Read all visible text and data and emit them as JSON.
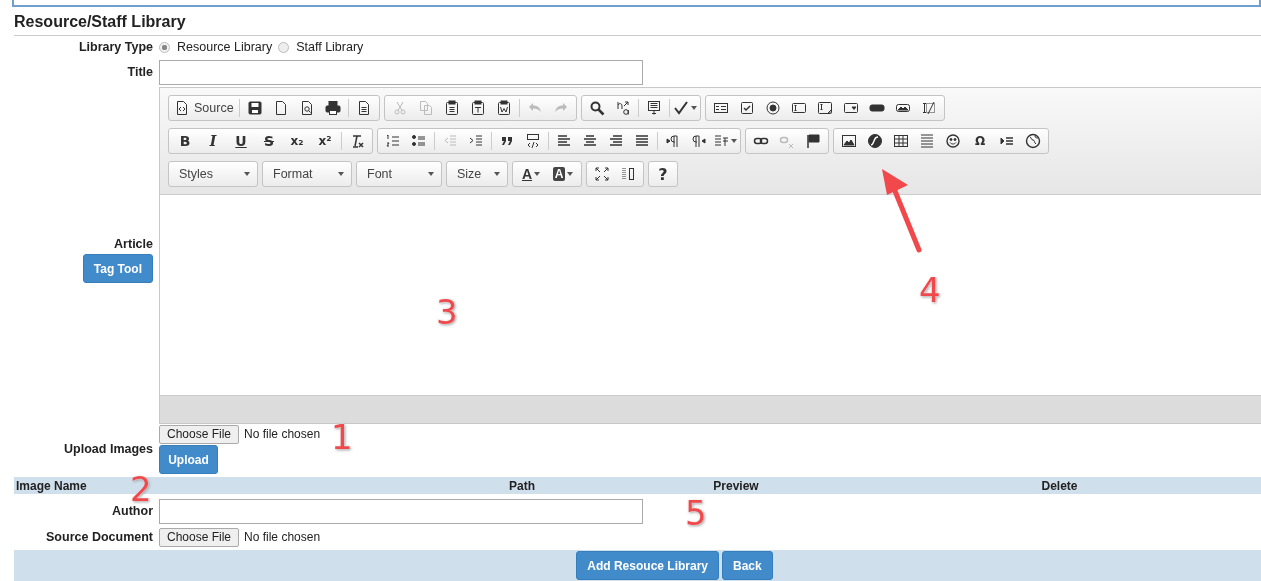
{
  "page_title": "Resource/Staff Library",
  "library_type": {
    "label": "Library Type",
    "options": [
      {
        "label": "Resource Library",
        "selected": true
      },
      {
        "label": "Staff Library",
        "selected": false
      }
    ]
  },
  "title_field": {
    "label": "Title"
  },
  "article": {
    "label": "Article",
    "tag_tool_button": "Tag Tool",
    "toolbar_rows": [
      {
        "groups": [
          {
            "items": [
              {
                "kind": "source",
                "text": "Source"
              },
              {
                "kind": "separator"
              },
              {
                "kind": "icon",
                "disabled": false
              },
              {
                "kind": "icon",
                "disabled": false
              },
              {
                "kind": "icon",
                "disabled": false
              },
              {
                "kind": "icon",
                "disabled": false
              },
              {
                "kind": "separator"
              },
              {
                "kind": "icon",
                "disabled": false
              }
            ]
          },
          {
            "items": [
              {
                "kind": "icon",
                "disabled": true
              },
              {
                "kind": "icon",
                "disabled": true
              },
              {
                "kind": "icon",
                "disabled": false
              },
              {
                "kind": "icon",
                "disabled": false
              },
              {
                "kind": "icon",
                "disabled": false
              },
              {
                "kind": "separator"
              },
              {
                "kind": "icon",
                "disabled": true
              },
              {
                "kind": "icon",
                "disabled": true
              }
            ]
          },
          {
            "items": [
              {
                "kind": "icon",
                "disabled": false
              },
              {
                "kind": "icon",
                "disabled": false
              },
              {
                "kind": "separator"
              },
              {
                "kind": "icon",
                "disabled": false
              },
              {
                "kind": "separator"
              },
              {
                "kind": "dropdown",
                "disabled": false
              }
            ]
          },
          {
            "items": [
              {
                "kind": "icon",
                "disabled": false
              },
              {
                "kind": "icon",
                "disabled": false
              },
              {
                "kind": "icon",
                "disabled": false
              },
              {
                "kind": "icon",
                "disabled": false
              },
              {
                "kind": "icon",
                "disabled": false
              },
              {
                "kind": "icon",
                "disabled": false
              },
              {
                "kind": "icon",
                "disabled": false
              },
              {
                "kind": "icon",
                "disabled": false
              },
              {
                "kind": "icon",
                "disabled": false
              }
            ]
          }
        ]
      },
      {
        "groups": [
          {
            "items": [
              {
                "kind": "glyph",
                "text": "B"
              },
              {
                "kind": "glyph",
                "text": "I"
              },
              {
                "kind": "glyph",
                "text": "U"
              },
              {
                "kind": "glyph",
                "text": "S"
              },
              {
                "kind": "glyph",
                "text": "x₂"
              },
              {
                "kind": "glyph",
                "text": "x²"
              },
              {
                "kind": "separator"
              },
              {
                "kind": "icon",
                "disabled": false
              }
            ]
          },
          {
            "items": [
              {
                "kind": "icon",
                "disabled": false
              },
              {
                "kind": "icon",
                "disabled": false
              },
              {
                "kind": "separator"
              },
              {
                "kind": "icon",
                "disabled": true
              },
              {
                "kind": "icon",
                "disabled": false
              },
              {
                "kind": "separator"
              },
              {
                "kind": "icon",
                "disabled": false
              },
              {
                "kind": "icon",
                "disabled": false
              },
              {
                "kind": "separator"
              },
              {
                "kind": "icon",
                "disabled": false
              },
              {
                "kind": "icon",
                "disabled": false
              },
              {
                "kind": "icon",
                "disabled": false
              },
              {
                "kind": "icon",
                "disabled": false
              },
              {
                "kind": "separator"
              },
              {
                "kind": "icon",
                "disabled": false
              },
              {
                "kind": "icon",
                "disabled": false
              },
              {
                "kind": "dropdown",
                "disabled": false
              }
            ]
          },
          {
            "items": [
              {
                "kind": "icon",
                "disabled": false
              },
              {
                "kind": "icon",
                "disabled": true
              },
              {
                "kind": "icon",
                "disabled": false
              }
            ]
          },
          {
            "items": [
              {
                "kind": "icon",
                "disabled": false
              },
              {
                "kind": "icon",
                "disabled": false
              },
              {
                "kind": "icon",
                "disabled": false
              },
              {
                "kind": "icon",
                "disabled": false
              },
              {
                "kind": "icon",
                "disabled": false
              },
              {
                "kind": "glyph",
                "text": "Ω"
              },
              {
                "kind": "icon",
                "disabled": false
              },
              {
                "kind": "icon",
                "disabled": false
              }
            ]
          }
        ]
      },
      {
        "groups": [
          {
            "items": [
              {
                "kind": "combo",
                "text": "Styles"
              }
            ]
          },
          {
            "items": [
              {
                "kind": "combo",
                "text": "Format"
              }
            ]
          },
          {
            "items": [
              {
                "kind": "combo",
                "text": "Font"
              }
            ]
          },
          {
            "items": [
              {
                "kind": "combo",
                "text": "Size"
              }
            ]
          },
          {
            "items": [
              {
                "kind": "text-color",
                "text": "A"
              },
              {
                "kind": "bg-color",
                "text": "A"
              }
            ]
          },
          {
            "items": [
              {
                "kind": "icon",
                "disabled": false
              },
              {
                "kind": "icon",
                "disabled": false
              }
            ]
          },
          {
            "items": [
              {
                "kind": "glyph",
                "text": "?"
              }
            ]
          }
        ]
      }
    ]
  },
  "upload_images": {
    "label": "Upload Images",
    "choose_button": "Choose File",
    "file_status": "No file chosen",
    "upload_button": "Upload"
  },
  "images_table": {
    "columns": [
      "Image Name",
      "Path",
      "Preview",
      "Delete"
    ]
  },
  "author_field": {
    "label": "Author"
  },
  "source_document": {
    "label": "Source Document",
    "choose_button": "Choose File",
    "file_status": "No file chosen"
  },
  "buttons": [
    "Add Resouce Library",
    "Back"
  ],
  "annotations": [
    {
      "kind": "number",
      "text": "1"
    },
    {
      "kind": "number",
      "text": "2"
    },
    {
      "kind": "number",
      "text": "3"
    },
    {
      "kind": "arrow"
    },
    {
      "kind": "number",
      "text": "4"
    },
    {
      "kind": "number",
      "text": "5"
    }
  ]
}
